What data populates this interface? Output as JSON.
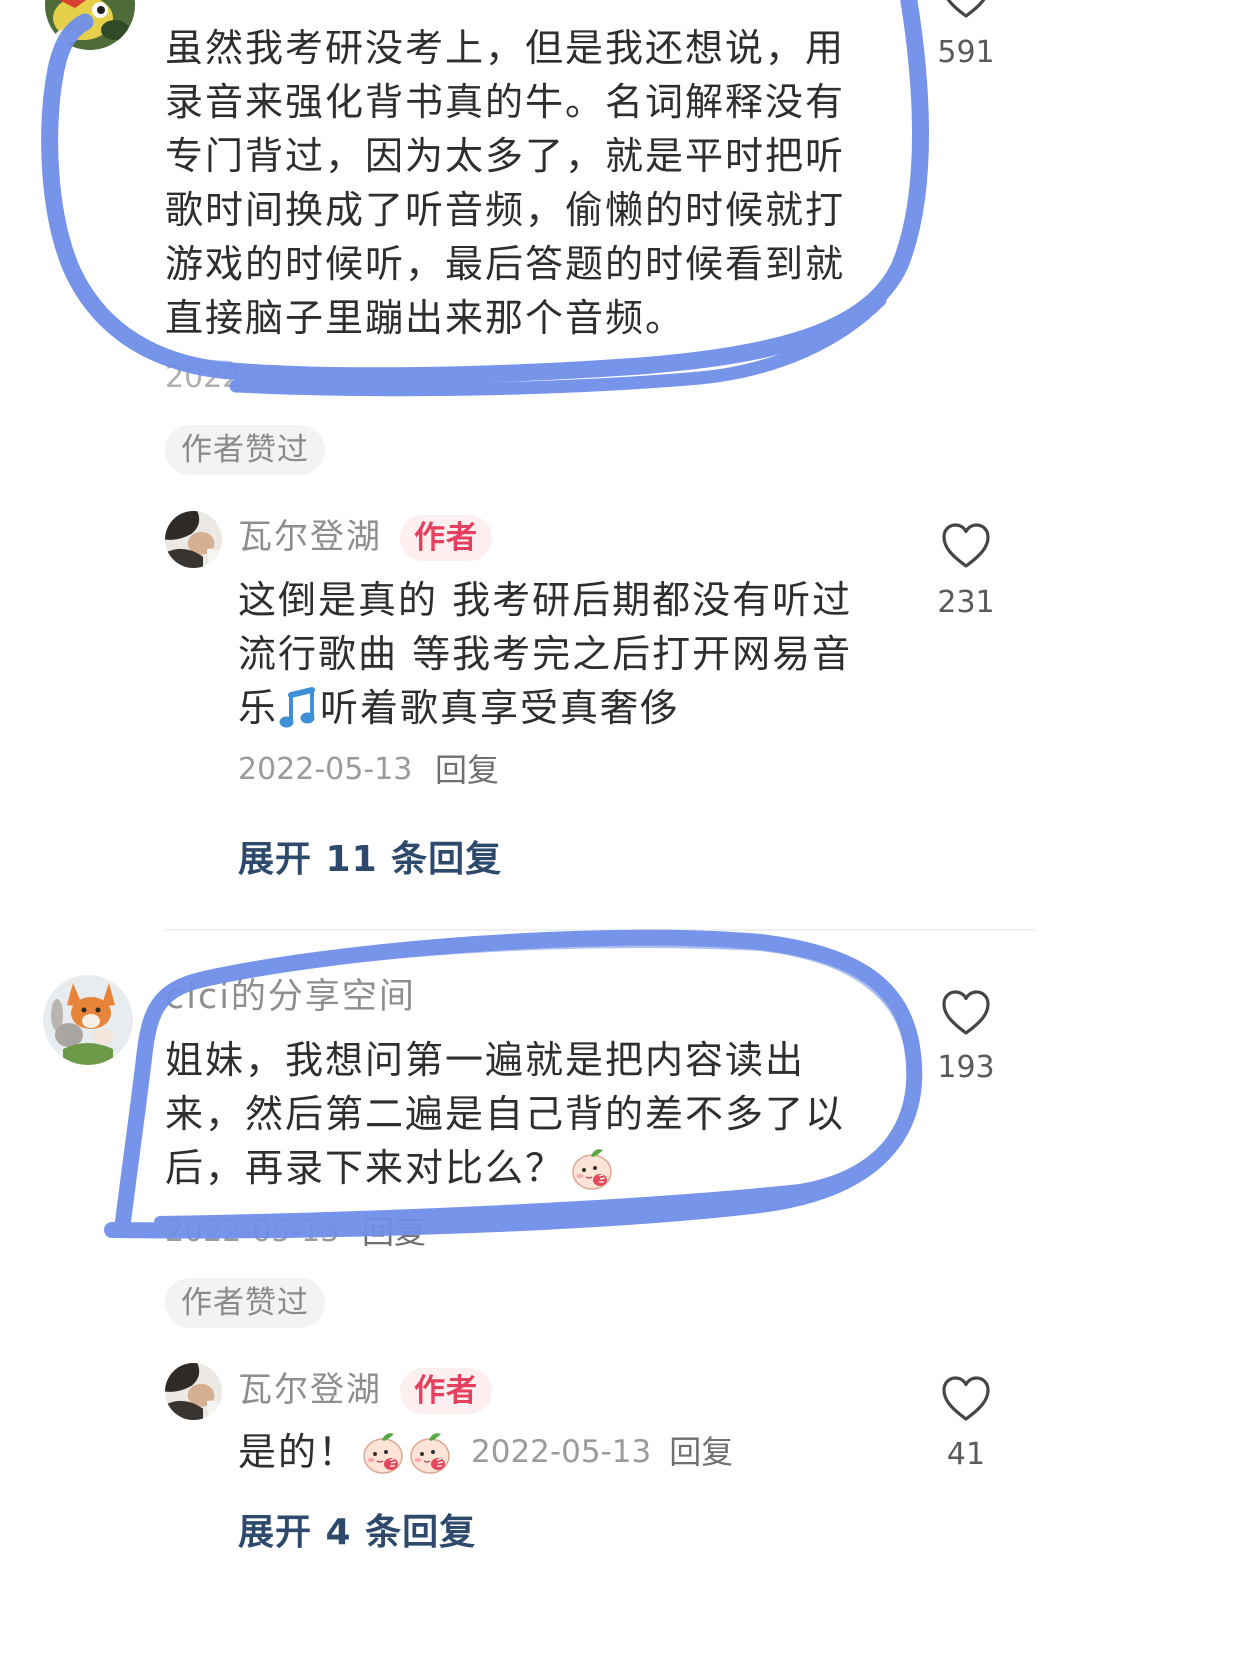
{
  "comments": [
    {
      "avatar_icon": "user-avatar",
      "text_lines": [
        "虽然我考研没考上，但是我还想说，用",
        "录音来强化背书真的牛。名词解释没有",
        "专门背过，因为太多了，就是平时把听",
        "歌时间换成了听音频，偷懒的时候就打",
        "游戏的时候听，最后答题的时候看到就",
        "直接脑子里蹦出来那个音频。"
      ],
      "date": "2022",
      "like_icon": "heart-outline-icon",
      "like_count": "591",
      "author_liked_badge": "作者赞过",
      "reply": {
        "author_name": "瓦尔登湖",
        "author_badge": "作者",
        "text_lines": [
          "这倒是真的 我考研后期都没有听过",
          "流行歌曲 等我考完之后打开网易音"
        ],
        "last_line_before_emoji": "乐",
        "emoji": "music-note-emoji",
        "last_line_after_emoji": "听着歌真享受真奢侈",
        "date": "2022-05-13",
        "reply_label": "回复",
        "like_icon": "heart-outline-icon",
        "like_count": "231"
      },
      "expand_replies_label": "展开 11 条回复"
    },
    {
      "author_name": "cici的分享空间",
      "text_lines": [
        "姐妹，我想问第一遍就是把内容读出",
        "来，然后第二遍是自己背的差不多了以"
      ],
      "last_line_text": "后，再录下来对比么？",
      "emoji": "shy-face-emoji",
      "date": "2022-05-13",
      "reply_label": "回复",
      "like_icon": "heart-outline-icon",
      "like_count": "193",
      "author_liked_badge": "作者赞过",
      "reply": {
        "author_name": "瓦尔登湖",
        "author_badge": "作者",
        "text": "是的！",
        "emojis": [
          "shy-face-emoji",
          "shy-face-emoji"
        ],
        "date": "2022-05-13",
        "reply_label": "回复",
        "like_icon": "heart-outline-icon",
        "like_count": "41"
      },
      "expand_replies_label": "展开 4 条回复"
    }
  ],
  "colors": {
    "marker_blue": "#6f8fe8",
    "author_badge_red": "#e5405e",
    "expand_link_navy": "#2d4a6c"
  }
}
